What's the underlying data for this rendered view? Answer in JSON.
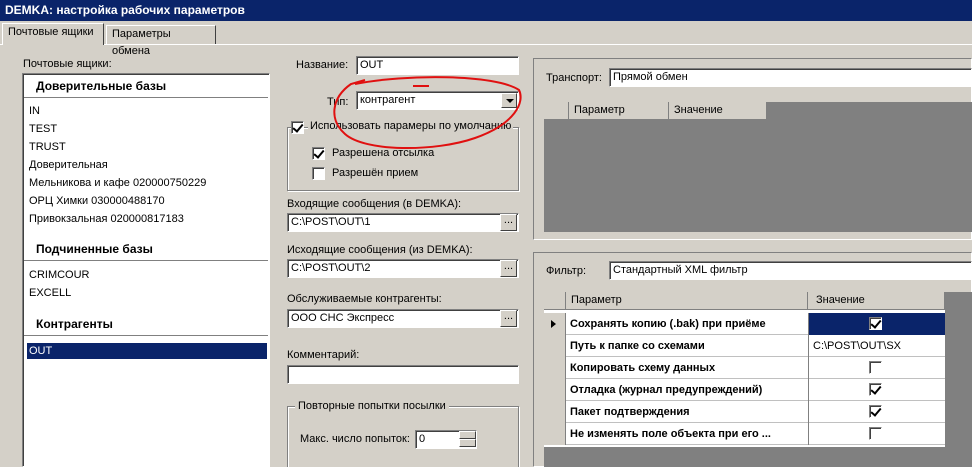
{
  "window": {
    "title": "DEMKA: настройка рабочих параметров"
  },
  "tabs": [
    {
      "label": "Почтовые ящики"
    },
    {
      "label": "Параметры обмена"
    }
  ],
  "mailboxes": {
    "label": "Почтовые ящики:",
    "trusted_header": "Доверительные базы",
    "trusted": [
      "IN",
      "TEST",
      "TRUST",
      "Доверительная",
      "Мельникова и кафе 020000750229",
      "ОРЦ Химки 030000488170",
      "Привокзальная 020000817183"
    ],
    "sub_header": "Подчиненные базы",
    "sub": [
      "CRIMCOUR",
      "EXCELL"
    ],
    "contr_header": "Контрагенты",
    "selected": "OUT"
  },
  "form": {
    "name_label": "Название:",
    "name_value": "OUT",
    "type_label": "Тип:",
    "type_value": "контрагент",
    "use_defaults_label": "Использовать парамеры по умолчанию",
    "send_allowed_label": "Разрешена отсылка",
    "receive_allowed_label": "Разрешён прием",
    "incoming_label": "Входящие сообщения (в DEMKA):",
    "incoming_value": "C:\\POST\\OUT\\1",
    "outgoing_label": "Исходящие сообщения (из DEMKA):",
    "outgoing_value": "C:\\POST\\OUT\\2",
    "served_label": "Обслуживаемые контрагенты:",
    "served_value": "ООО СНС Экспресс",
    "comment_label": "Комментарий:",
    "comment_value": "",
    "retry_group": "Повторные попытки посылки",
    "max_attempts_label": "Макс. число попыток:",
    "max_attempts_value": "0",
    "browse": "..."
  },
  "transport": {
    "label": "Транспорт:",
    "value": "Прямой обмен",
    "col_param": "Параметр",
    "col_value": "Значение"
  },
  "filter": {
    "label": "Фильтр:",
    "value": "Стандартный XML фильтр",
    "col_param": "Параметр",
    "col_value": "Значение",
    "rows": [
      {
        "name": "Сохранять копию (.bak) при приёме",
        "type": "check",
        "checked": true
      },
      {
        "name": "Путь к папке со схемами",
        "type": "text",
        "value": "C:\\POST\\OUT\\SX"
      },
      {
        "name": "Копировать схему данных",
        "type": "check",
        "checked": false
      },
      {
        "name": "Отладка (журнал предупреждений)",
        "type": "check",
        "checked": true
      },
      {
        "name": "Пакет подтверждения",
        "type": "check",
        "checked": true
      },
      {
        "name": "Не изменять поле объекта при его ...",
        "type": "check",
        "checked": false
      }
    ]
  },
  "colors": {
    "titlebar": "#0a246a",
    "face": "#d4d0c8",
    "annotation": "#e01010"
  }
}
